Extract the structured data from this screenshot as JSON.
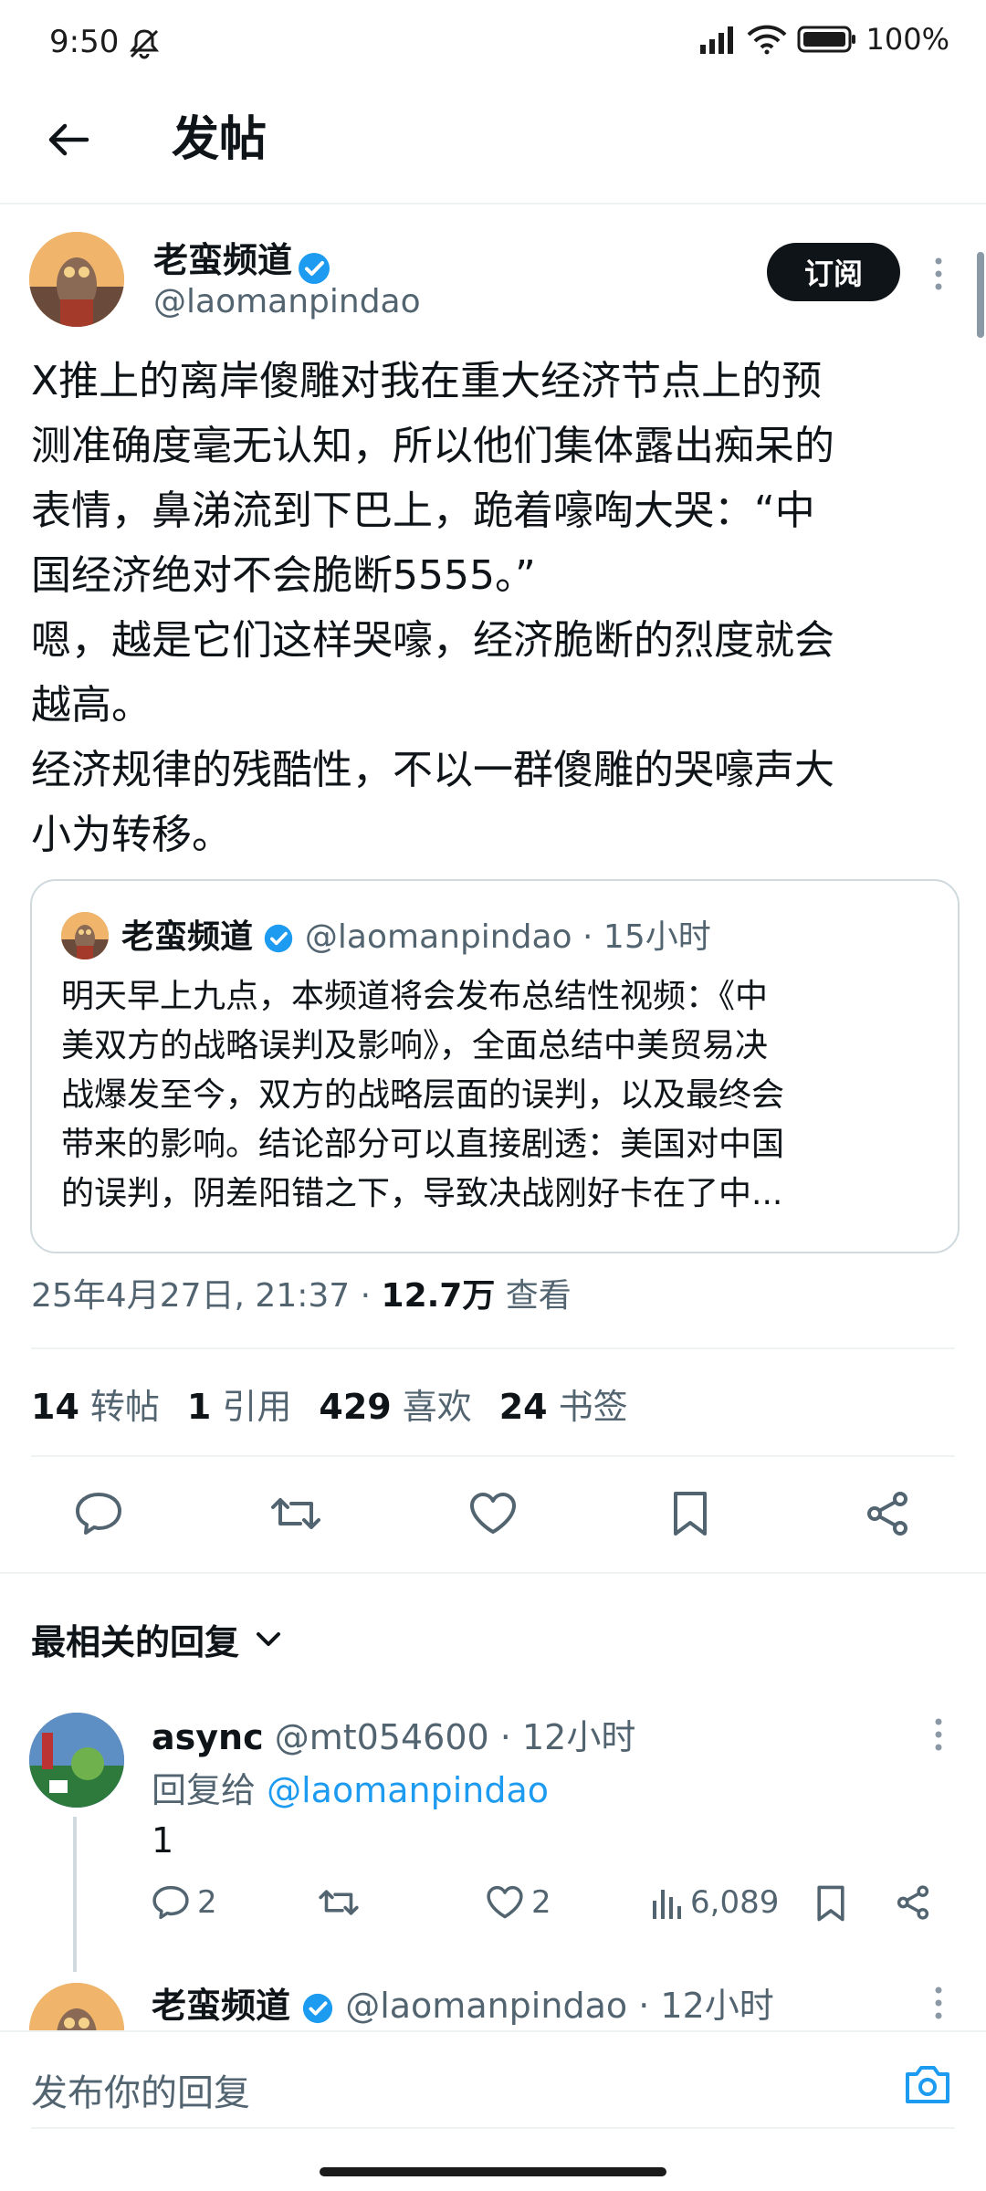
{
  "status_bar": {
    "time": "9:50",
    "battery": "100%"
  },
  "header": {
    "title": "发帖"
  },
  "post": {
    "author_name": "老蛮频道",
    "handle": "@laomanpindao",
    "subscribe_label": "订阅",
    "text": "X推上的离岸傻雕对我在重大经济节点上的预\n测准确度毫无认知，所以他们集体露出痴呆的\n表情，鼻涕流到下巴上，跪着嚎啕大哭：“中\n国经济绝对不会脆断5555。”\n嗯，越是它们这样哭嚎，经济脆断的烈度就会\n越高。\n经济规律的残酷性，不以一群傻雕的哭嚎声大\n小为转移。",
    "quote": {
      "author_name": "老蛮频道",
      "handle": "@laomanpindao",
      "time": "15小时",
      "text": "明天早上九点，本频道将会发布总结性视频：《中\n美双方的战略误判及影响》，全面总结中美贸易决\n战爆发至今，双方的战略层面的误判，以及最终会\n带来的影响。结论部分可以直接剧透：美国对中国\n的误判，阴差阳错之下，导致决战刚好卡在了中..."
    },
    "timestamp": "25年4月27日, 21:37",
    "views_count": "12.7万",
    "views_label": "查看",
    "stats": {
      "reposts_count": "14",
      "reposts_label": "转帖",
      "quotes_count": "1",
      "quotes_label": "引用",
      "likes_count": "429",
      "likes_label": "喜欢",
      "bookmarks_count": "24",
      "bookmarks_label": "书签"
    }
  },
  "replies_filter": {
    "label": "最相关的回复"
  },
  "replies": [
    {
      "author_name": "async",
      "handle": "@mt054600",
      "time": "12小时",
      "reply_to_prefix": "回复给",
      "reply_to_handle": "@laomanpindao",
      "text": "1",
      "comments": "2",
      "likes": "2",
      "views": "6,089"
    },
    {
      "author_name": "老蛮频道",
      "handle": "@laomanpindao",
      "time": "12小时"
    }
  ],
  "compose": {
    "placeholder": "发布你的回复"
  },
  "colors": {
    "accent": "#1d9bf0",
    "text": "#0f1419",
    "muted": "#536471",
    "border": "#cfd9de"
  }
}
